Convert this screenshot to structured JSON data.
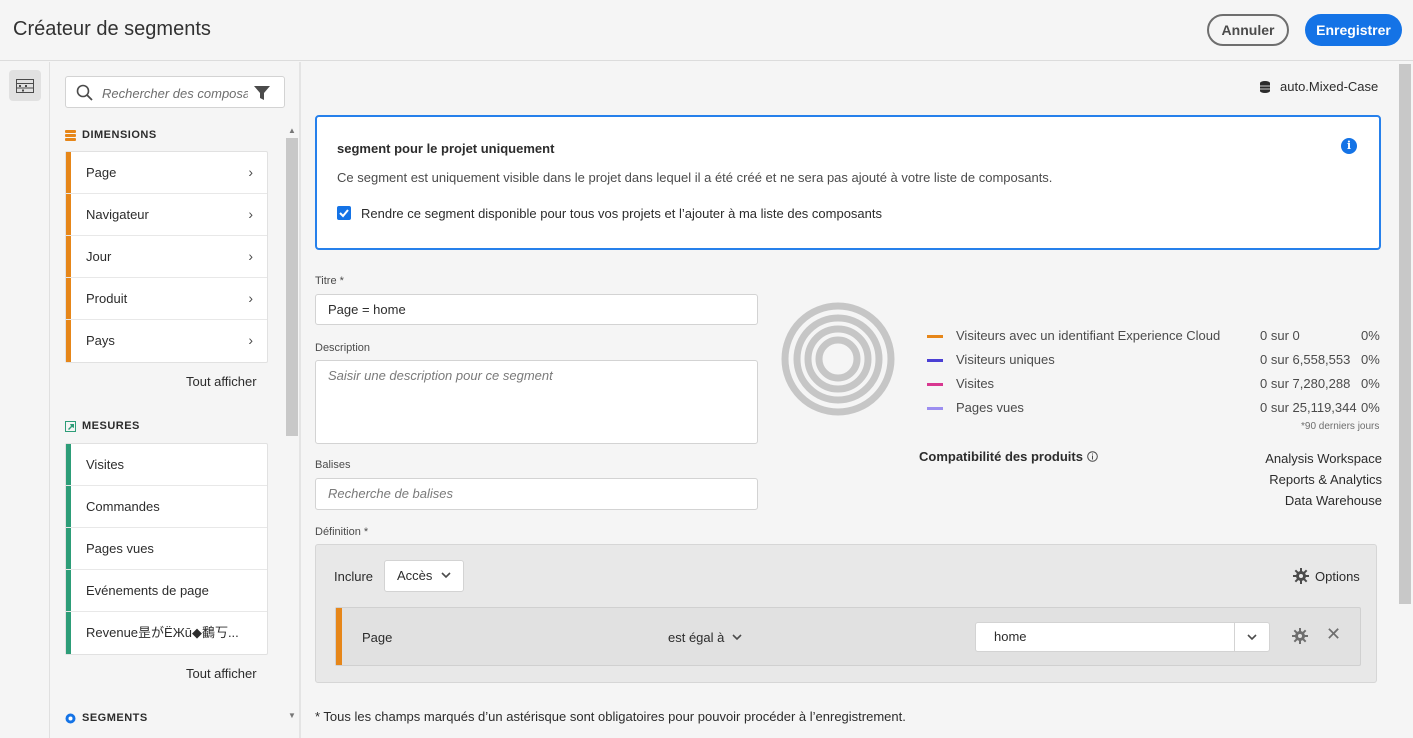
{
  "header": {
    "title": "Créateur de segments",
    "cancel_label": "Annuler",
    "save_label": "Enregistrer"
  },
  "rail": {
    "icon": "components-panel-icon"
  },
  "panel": {
    "search_placeholder": "Rechercher des composan",
    "dimensions": {
      "title": "DIMENSIONS",
      "color": "#e68619",
      "items": [
        {
          "label": "Page"
        },
        {
          "label": "Navigateur"
        },
        {
          "label": "Jour"
        },
        {
          "label": "Produit"
        },
        {
          "label": "Pays"
        }
      ],
      "show_all": "Tout afficher"
    },
    "metrics": {
      "title": "MESURES",
      "color": "#2d9d78",
      "items": [
        {
          "label": "Visites"
        },
        {
          "label": "Commandes"
        },
        {
          "label": "Pages vues"
        },
        {
          "label": "Evénements de page"
        },
        {
          "label": "Revenue昰がЁЖū◆鷭丂..."
        }
      ],
      "show_all": "Tout afficher"
    },
    "segments": {
      "title": "SEGMENTS",
      "color": "#1473e6"
    }
  },
  "main": {
    "datasource": "auto.Mixed-Case",
    "notice": {
      "title": "segment pour le projet uniquement",
      "text": "Ce segment est uniquement visible dans le projet dans lequel il a été créé et ne sera pas ajouté à votre liste de composants.",
      "checkbox_label": "Rendre ce segment disponible pour tous vos projets et l’ajouter à ma liste des composants",
      "checked": true
    },
    "title_label": "Titre",
    "title_value": "Page = home",
    "description_label": "Description",
    "description_placeholder": "Saisir une description pour ce segment",
    "tags_label": "Balises",
    "tags_placeholder": "Recherche de balises",
    "summary": {
      "rows": [
        {
          "name": "Visiteurs avec un identifiant Experience Cloud",
          "count": "0 sur 0",
          "pct": "0%",
          "color": "#e68619"
        },
        {
          "name": "Visiteurs uniques",
          "count": "0 sur 6,558,553",
          "pct": "0%",
          "color": "#4b3fd4"
        },
        {
          "name": "Visites",
          "count": "0 sur 7,280,288",
          "pct": "0%",
          "color": "#d83790"
        },
        {
          "name": "Pages vues",
          "count": "0 sur 25,119,344",
          "pct": "0%",
          "color": "#9c8ef0"
        }
      ],
      "last_days": "*90 derniers jours"
    },
    "compat": {
      "label": "Compatibilité des produits",
      "products": [
        "Analysis Workspace",
        "Reports & Analytics",
        "Data Warehouse"
      ]
    },
    "definition": {
      "label": "Définition",
      "include": "Inclure",
      "container": "Accès",
      "options": "Options",
      "rule": {
        "dimension": "Page",
        "operator": "est égal à",
        "value": "home"
      }
    },
    "footnote": "* Tous les champs marqués d’un astérisque sont obligatoires pour pouvoir procéder à l’enregistrement."
  }
}
